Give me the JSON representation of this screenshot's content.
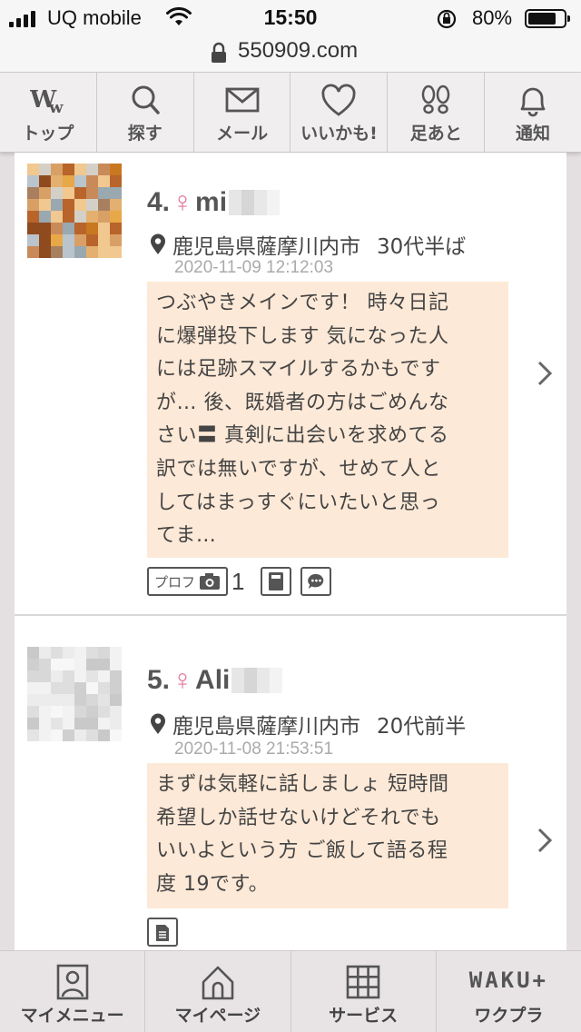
{
  "status_bar": {
    "carrier": "UQ mobile",
    "time": "15:50",
    "battery": "80%"
  },
  "browser": {
    "url": "550909.com"
  },
  "top_nav": [
    {
      "label": "トップ",
      "icon": "ww-logo-icon"
    },
    {
      "label": "探す",
      "icon": "search-icon"
    },
    {
      "label": "メール",
      "icon": "mail-icon"
    },
    {
      "label": "いいかも!",
      "icon": "heart-icon"
    },
    {
      "label": "足あと",
      "icon": "footprints-icon"
    },
    {
      "label": "通知",
      "icon": "bell-icon"
    }
  ],
  "posts": [
    {
      "number": "4.",
      "gender_symbol": "♀",
      "name_visible": "mi",
      "location": "鹿児島県薩摩川内市",
      "age": "30代半ば",
      "date": "2020-11-09 12:12:03",
      "message_lines": [
        "つぶやきメインです！ 時々日記",
        "に爆弾投下します 気になった人",
        "には足跡スマイルするかもです",
        "が… 後、既婚者の方はごめんな",
        "さい〓 真剣に出会いを求めてる",
        "訳では無いですが、せめて人と",
        "してはまっすぐにいたいと思っ",
        "てま…"
      ],
      "badges": {
        "prof_label": "プロフ",
        "photo_count": "1"
      }
    },
    {
      "number": "5.",
      "gender_symbol": "♀",
      "name_visible": "Ali",
      "location": "鹿児島県薩摩川内市",
      "age": "20代前半",
      "date": "2020-11-08 21:53:51",
      "message_lines": [
        "まずは気軽に話しましょ 短時間",
        "希望しか話せないけどそれでも",
        "いいよという方 ご飯して語る程",
        "度 19です。"
      ]
    }
  ],
  "bottom_nav": [
    {
      "label": "マイメニュー",
      "icon": "user-card-icon"
    },
    {
      "label": "マイページ",
      "icon": "home-icon"
    },
    {
      "label": "サービス",
      "icon": "grid-icon"
    },
    {
      "label": "ワクプラ",
      "logo": "WAKU+"
    }
  ],
  "colors": {
    "accent_pink": "#e2789f",
    "message_bg": "#fde9d7",
    "nav_bg": "#f1eef0"
  }
}
